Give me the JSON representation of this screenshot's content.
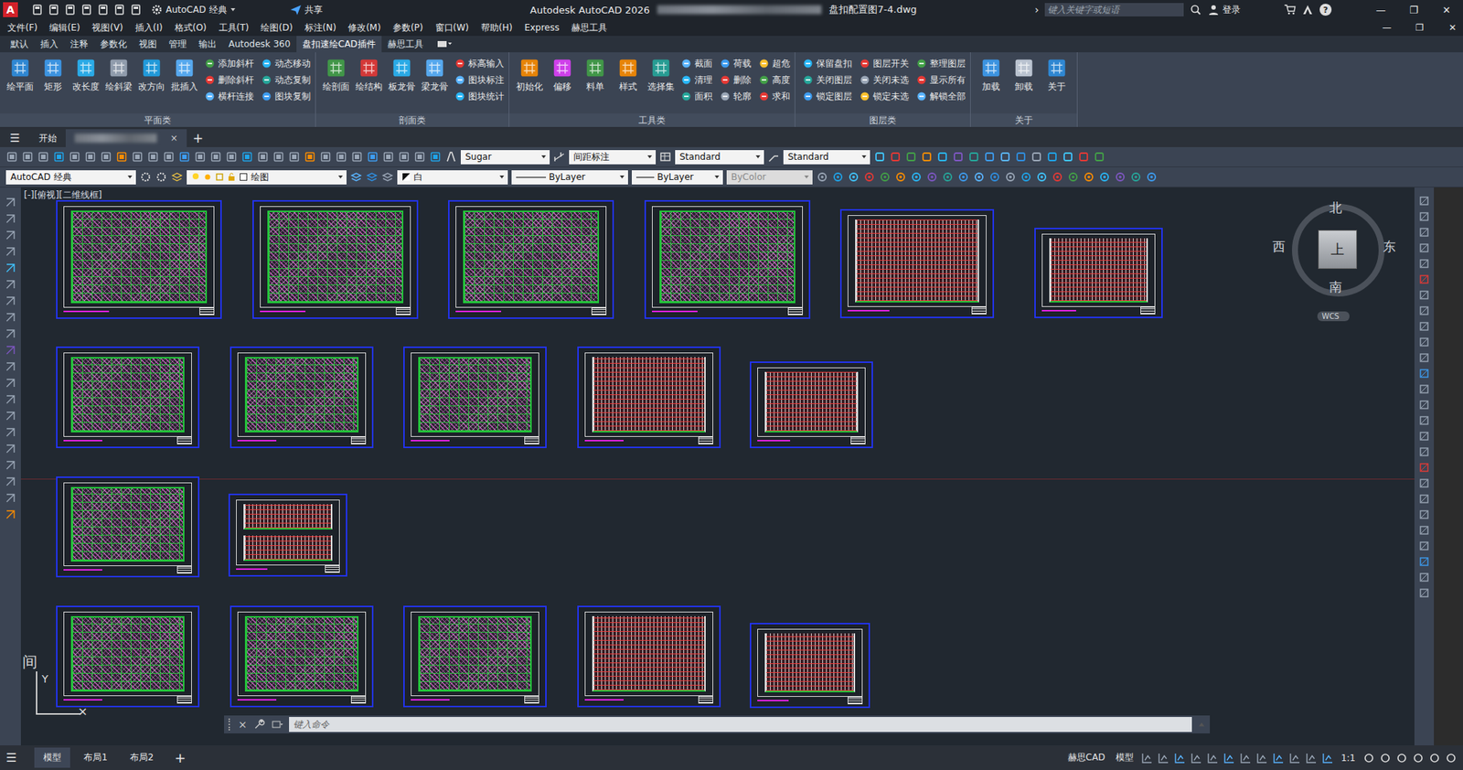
{
  "title_bar": {
    "logo": "A",
    "workspace": "AutoCAD 经典",
    "share": "共享",
    "app": "Autodesk AutoCAD 2026",
    "file": "盘扣配置图7-4.dwg",
    "search_caret": "›",
    "search_placeholder": "键入关键字或短语",
    "login": "登录",
    "help": "?",
    "controls": [
      "—",
      "❐",
      "✕"
    ]
  },
  "menu": {
    "items": [
      "文件(F)",
      "编辑(E)",
      "视图(V)",
      "插入(I)",
      "格式(O)",
      "工具(T)",
      "绘图(D)",
      "标注(N)",
      "修改(M)",
      "参数(P)",
      "窗口(W)",
      "帮助(H)",
      "Express",
      "赫思工具"
    ],
    "controls": [
      "—",
      "❐",
      "✕"
    ]
  },
  "ribbon_tabs": [
    {
      "label": "默认",
      "selected": false
    },
    {
      "label": "插入",
      "selected": false
    },
    {
      "label": "注释",
      "selected": false
    },
    {
      "label": "参数化",
      "selected": false
    },
    {
      "label": "视图",
      "selected": false
    },
    {
      "label": "管理",
      "selected": false
    },
    {
      "label": "输出",
      "selected": false
    },
    {
      "label": "Autodesk 360",
      "selected": false
    },
    {
      "label": "盘扣速绘CAD插件",
      "selected": true
    },
    {
      "label": "赫思工具",
      "selected": false
    }
  ],
  "ribbon_groups": [
    {
      "title": "平面类",
      "large": [
        "绘平面",
        "矩形",
        "改长度",
        "绘斜梁",
        "改方向",
        "批插入"
      ],
      "small": [
        "添加斜杆",
        "删除斜杆",
        "横杆连接",
        "动态移动",
        "动态复制",
        "图块复制"
      ]
    },
    {
      "title": "剖面类",
      "large": [
        "绘剖面",
        "绘结构",
        "板龙骨",
        "梁龙骨"
      ],
      "small": [
        "标高输入",
        "图块标注",
        "图块统计"
      ]
    },
    {
      "title": "工具类",
      "large": [
        "初始化",
        "偏移",
        "料单",
        "样式",
        "选择集"
      ],
      "small": [
        "截面",
        "清理",
        "面积",
        "荷载",
        "删除",
        "轮廓",
        "超危",
        "高度",
        "求和"
      ]
    },
    {
      "title": "图层类",
      "large": [],
      "small": [
        "保留盘扣",
        "关闭图层",
        "锁定图层",
        "图层开关",
        "关闭未选",
        "锁定未选",
        "整理图层",
        "显示所有",
        "解锁全部"
      ]
    },
    {
      "title": "关于",
      "large": [
        "加载",
        "卸载",
        "关于"
      ],
      "small": []
    }
  ],
  "doc_tabs": {
    "menu": "☰",
    "tabs": [
      {
        "label": "开始",
        "selected": false,
        "closable": false,
        "blurred": false
      },
      {
        "label": "",
        "selected": true,
        "closable": true,
        "blurred": true
      }
    ],
    "close": "×",
    "add": "+"
  },
  "toolbar": {
    "text_style": "Sugar",
    "dim_style": "间距标注",
    "table_style": "Standard",
    "mleader_style": "Standard",
    "workspace": "AutoCAD 经典",
    "layer": "绘图",
    "color": "白",
    "linetype": "ByLayer",
    "lineweight": "ByLayer",
    "plot_style": "ByColor",
    "plot_style_disabled": true
  },
  "viewport": {
    "label": "[-][俯视][二维线框]"
  },
  "viewcube": {
    "north": "北",
    "south": "南",
    "east": "东",
    "west": "西",
    "face": "上",
    "ucs": "WCS"
  },
  "ucs_icon": {
    "y": "Y",
    "x": "×"
  },
  "canvas_text": "间",
  "sheets": [
    {
      "kind": "plan"
    },
    {
      "kind": "plan"
    },
    {
      "kind": "plan"
    },
    {
      "kind": "plan"
    },
    {
      "kind": "elevation"
    },
    {
      "kind": "elevation"
    },
    {
      "kind": "plan"
    },
    {
      "kind": "plan"
    },
    {
      "kind": "plan"
    },
    {
      "kind": "elevation"
    },
    {
      "kind": "elevation"
    },
    {
      "kind": "plan"
    },
    {
      "kind": "elevation-pair"
    },
    {
      "kind": "plan"
    },
    {
      "kind": "plan"
    },
    {
      "kind": "plan"
    },
    {
      "kind": "elevation"
    },
    {
      "kind": "elevation"
    }
  ],
  "command": {
    "placeholder": "键入命令",
    "close": "×"
  },
  "layout_tabs": {
    "menu": "☰",
    "tabs": [
      {
        "label": "模型",
        "selected": true
      },
      {
        "label": "布局1",
        "selected": false
      },
      {
        "label": "布局2",
        "selected": false
      }
    ],
    "add": "+"
  },
  "status": {
    "plugin": "赫思CAD",
    "space": "模型",
    "scale": "1:1"
  }
}
